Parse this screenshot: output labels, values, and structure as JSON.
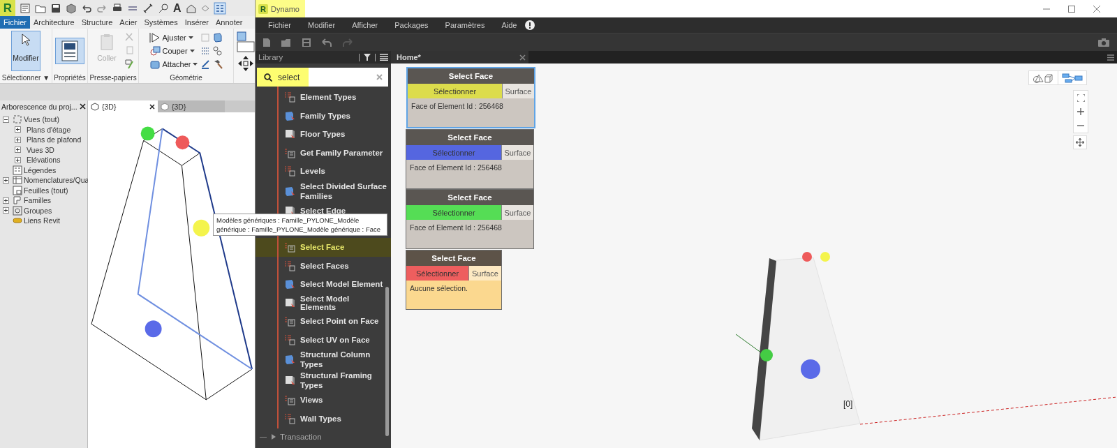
{
  "revit": {
    "logo": "R",
    "text_tool": "A",
    "ribbon_tabs": [
      {
        "label": "Fichier",
        "selected": true
      },
      {
        "label": "Architecture",
        "selected": false
      },
      {
        "label": "Structure",
        "selected": false
      },
      {
        "label": "Acier",
        "selected": false
      },
      {
        "label": "Systèmes",
        "selected": false
      },
      {
        "label": "Insérer",
        "selected": false
      },
      {
        "label": "Annoter",
        "selected": false
      }
    ],
    "ribbon": {
      "select_panel": {
        "title": "Sélectionner",
        "caret": "▼",
        "modify_button": {
          "label": "Modifier",
          "selected": true
        }
      },
      "properties_panel": {
        "title": "Propriétés"
      },
      "clipboard_panel": {
        "title": "Presse-papiers",
        "paste": {
          "label": "Coller",
          "disabled": true
        }
      },
      "geometry_panel": {
        "title": "Géométrie",
        "tools": [
          {
            "label": "Ajuster"
          },
          {
            "label": "Couper"
          },
          {
            "label": "Attacher"
          }
        ]
      }
    },
    "project_browser": {
      "title": "Arborescence du proj...",
      "tree": [
        {
          "label": "Vues (tout)",
          "expanded": true,
          "children": [
            {
              "label": "Plans d'étage",
              "expanded": false
            },
            {
              "label": "Plans de plafond",
              "expanded": false
            },
            {
              "label": "Vues 3D",
              "expanded": false
            },
            {
              "label": "Elévations",
              "expanded": false
            }
          ]
        },
        {
          "label": "Légendes"
        },
        {
          "label": "Nomenclatures/Qua",
          "expanded": false
        },
        {
          "label": "Feuilles (tout)"
        },
        {
          "label": "Familles",
          "expanded": false
        },
        {
          "label": "Groupes",
          "expanded": false
        },
        {
          "label": "Liens Revit"
        }
      ]
    },
    "view_tabs": [
      {
        "label": "{3D}",
        "selected": true
      },
      {
        "label": "{3D}",
        "selected": false
      }
    ]
  },
  "dynamo": {
    "logo": "R",
    "title": "Dynamo",
    "menu": [
      "Fichier",
      "Modifier",
      "Afficher",
      "Packages",
      "Paramètres",
      "Aide"
    ],
    "library": {
      "title": "Library",
      "search": "select",
      "items": [
        {
          "label": "Element Types",
          "selected": false
        },
        {
          "label": "Family Types",
          "selected": false
        },
        {
          "label": "Floor Types",
          "selected": false
        },
        {
          "label": "Get Family Parameter",
          "selected": false
        },
        {
          "label": "Levels",
          "selected": false
        },
        {
          "label": "Select Divided Surface Families",
          "selected": false
        },
        {
          "label": "Select Edge",
          "selected": false
        },
        {
          "label": "Select Face",
          "selected": true
        },
        {
          "label": "Select Faces",
          "selected": false
        },
        {
          "label": "Select Model Element",
          "selected": false
        },
        {
          "label": "Select Model Elements",
          "selected": false
        },
        {
          "label": "Select Point on Face",
          "selected": false
        },
        {
          "label": "Select UV on Face",
          "selected": false
        },
        {
          "label": "Structural Column Types",
          "selected": false
        },
        {
          "label": "Structural Framing Types",
          "selected": false
        },
        {
          "label": "Views",
          "selected": false
        },
        {
          "label": "Wall Types",
          "selected": false
        }
      ],
      "category": {
        "label": "Transaction",
        "expanded": false
      }
    },
    "tabs": [
      {
        "label": "Home*",
        "selected": true
      }
    ],
    "nodes": [
      {
        "title": "Select Face",
        "button": "Sélectionner",
        "color": "#dcdc4c",
        "output": "Surface",
        "result": "Face of Element Id : 256468",
        "selected": true,
        "warning": false
      },
      {
        "title": "Select Face",
        "button": "Sélectionner",
        "color": "#5566e0",
        "output": "Surface",
        "result": "Face of Element Id : 256468",
        "selected": false,
        "warning": false
      },
      {
        "title": "Select Face",
        "button": "Sélectionner",
        "color": "#55dd55",
        "output": "Surface",
        "result": "Face of Element Id : 256468",
        "selected": false,
        "warning": false
      },
      {
        "title": "Select Face",
        "button": "Sélectionner",
        "color": "#ee5e5e",
        "output": "Surface",
        "result": "Aucune sélection.",
        "selected": false,
        "warning": true
      }
    ],
    "preview_label": "[0]"
  },
  "tooltip": [
    "Modèles génériques : Famille_PYLONE_Modèle",
    "générique : Famille_PYLONE_Modèle générique : Face"
  ]
}
